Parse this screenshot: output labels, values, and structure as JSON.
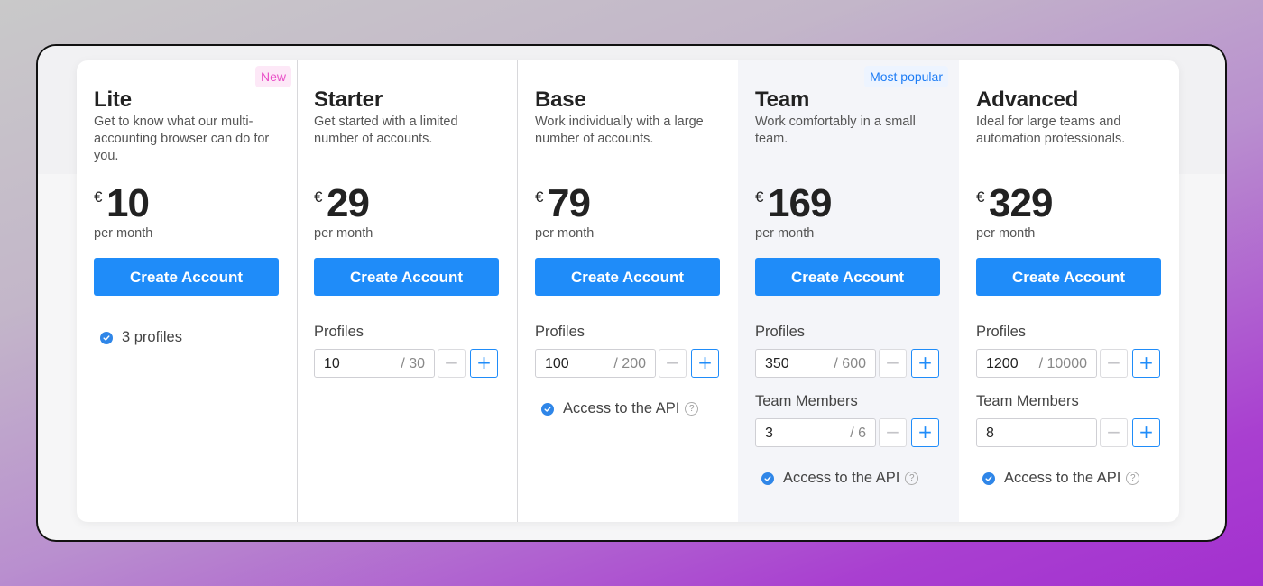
{
  "colors": {
    "accent": "#1f8cf9",
    "check": "#2f86e8",
    "new_badge": "#e94fc7",
    "popular_badge": "#1e7df5"
  },
  "plans": [
    {
      "badge": "New",
      "name": "Lite",
      "description": "Get to know what our multi-accounting browser can do for you.",
      "currency": "€",
      "price": "10",
      "period": "per month",
      "cta": "Create Account",
      "profiles_text": "3 profiles"
    },
    {
      "name": "Starter",
      "description": "Get started with a limited number of accounts.",
      "currency": "€",
      "price": "29",
      "period": "per month",
      "cta": "Create Account",
      "profiles_label": "Profiles",
      "profiles_value": "10",
      "profiles_max": "/ 30"
    },
    {
      "name": "Base",
      "description": "Work individually with a large number of accounts.",
      "currency": "€",
      "price": "79",
      "period": "per month",
      "cta": "Create Account",
      "profiles_label": "Profiles",
      "profiles_value": "100",
      "profiles_max": "/ 200",
      "api_text": "Access to the API"
    },
    {
      "badge": "Most popular",
      "name": "Team",
      "description": "Work comfortably in a small team.",
      "currency": "€",
      "price": "169",
      "period": "per month",
      "cta": "Create Account",
      "profiles_label": "Profiles",
      "profiles_value": "350",
      "profiles_max": "/ 600",
      "members_label": "Team Members",
      "members_value": "3",
      "members_max": "/ 6",
      "api_text": "Access to the API"
    },
    {
      "name": "Advanced",
      "description": "Ideal for large teams and automation professionals.",
      "currency": "€",
      "price": "329",
      "period": "per month",
      "cta": "Create Account",
      "profiles_label": "Profiles",
      "profiles_value": "1200",
      "profiles_max": "/ 10000",
      "members_label": "Team Members",
      "members_value": "8",
      "api_text": "Access to the API"
    }
  ],
  "icons": {
    "check": "check-circle-icon",
    "help": "question-circle-icon",
    "minus": "minus-icon",
    "plus": "plus-icon"
  },
  "stepper_symbols": {
    "minus": "−",
    "plus": "+",
    "help": "?"
  }
}
